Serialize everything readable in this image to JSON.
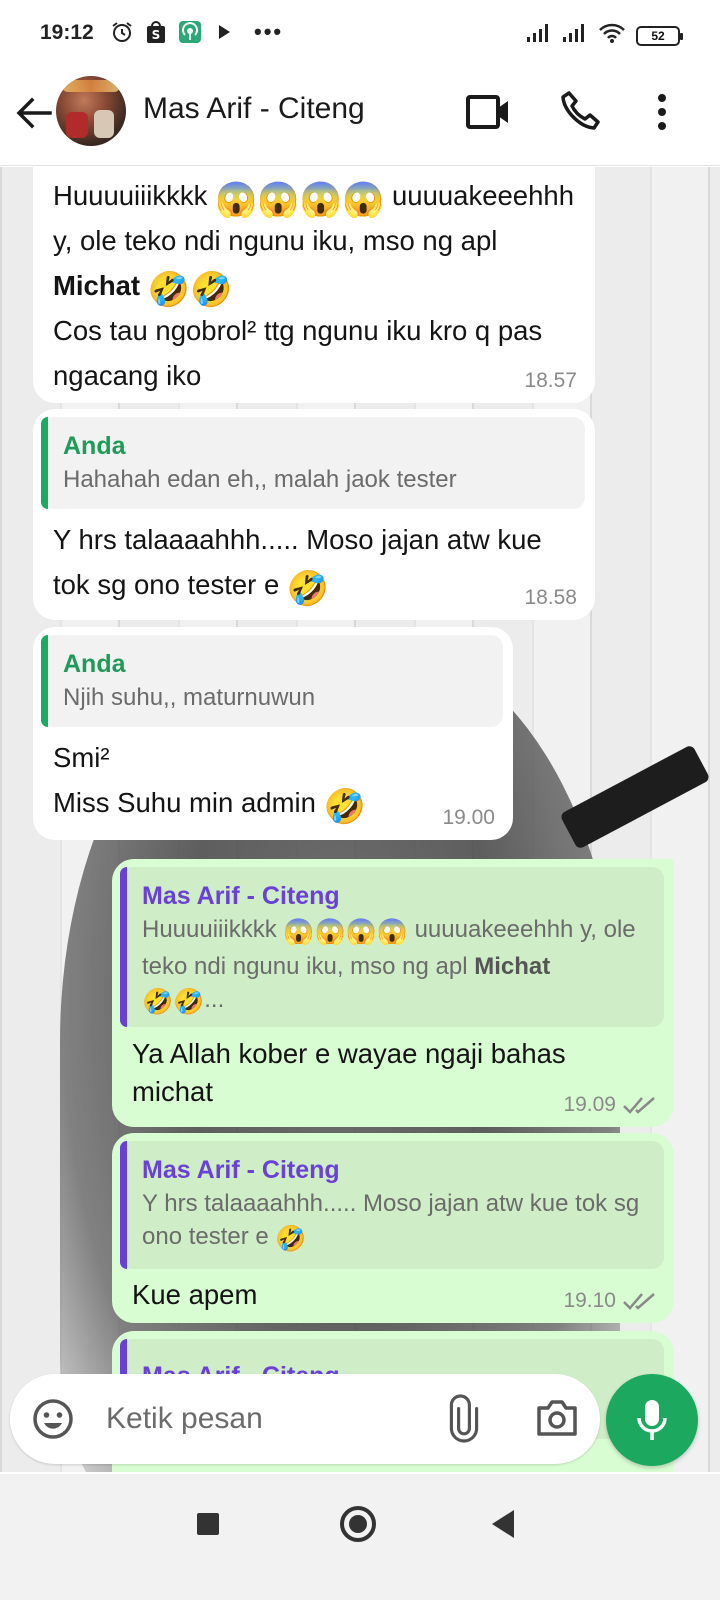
{
  "status_bar": {
    "time": "19:12",
    "battery": "52",
    "icons": [
      "alarm-icon",
      "shop-icon",
      "podcast-icon",
      "play-icon",
      "more-icon",
      "signal-icon",
      "signal-icon",
      "wifi-icon",
      "battery-icon"
    ]
  },
  "header": {
    "contact_name": "Mas Arif - Citeng",
    "icons": [
      "back-arrow-icon",
      "video-call-icon",
      "phone-icon",
      "more-vert-icon"
    ]
  },
  "messages": [
    {
      "direction": "incoming",
      "text_segments": [
        "Huuuuiiikkkk ",
        "😱😱😱😱",
        " uuuuakeeehhh y, ole teko ndi ngunu iku, mso ng apl ",
        "Michat",
        " ",
        "🤣🤣",
        "Cos tau ngobrol² ttg ngunu iku kro q pas ngacang iko"
      ],
      "time": "18.57"
    },
    {
      "direction": "incoming",
      "quote": {
        "author": "Anda",
        "text": "Hahahah edan eh,, malah jaok tester"
      },
      "text": "Y hrs talaaaahhh..... Moso jajan atw kue tok sg ono tester e",
      "emoji": "🤣",
      "time": "18.58"
    },
    {
      "direction": "incoming",
      "quote": {
        "author": "Anda",
        "text": "Njih suhu,, maturnuwun"
      },
      "line1": "Smi²",
      "line2": "Miss Suhu min admin",
      "emoji": "🤣",
      "time": "19.00"
    },
    {
      "direction": "outgoing",
      "quote": {
        "author": "Mas Arif - Citeng",
        "text_a": "Huuuuiiikkkk",
        "emoji_a": "😱😱😱😱",
        "text_b": "uuuuakeeehhh y, ole teko ndi ngunu iku, mso ng apl",
        "bold": "Michat",
        "emoji_b": "🤣🤣",
        "ellipsis": "..."
      },
      "text": "Ya Allah kober e wayae ngaji bahas michat",
      "time": "19.09",
      "status": "read"
    },
    {
      "direction": "outgoing",
      "quote": {
        "author": "Mas Arif - Citeng",
        "text": "Y hrs talaaaahhh..... Moso jajan atw kue tok sg ono tester e",
        "emoji": "🤣"
      },
      "text": "Kue apem",
      "time": "19.10",
      "status": "read"
    },
    {
      "direction": "outgoing",
      "quote": {
        "author": "Mas Arif - Citeng"
      }
    }
  ],
  "input": {
    "placeholder": "Ketik pesan"
  },
  "colors": {
    "outgoing_bubble": "#d9fdd3",
    "incoming_bubble": "#ffffff",
    "accent_green": "#1ca85e",
    "quote_purple": "#6a40d8",
    "quote_green": "#1f9a59"
  }
}
